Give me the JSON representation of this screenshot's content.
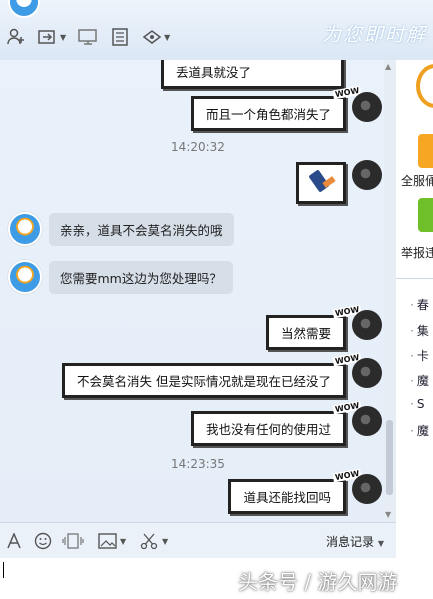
{
  "header": {
    "slogan": "为您即时解",
    "tool_icons": [
      "add-contact-icon",
      "transfer-icon",
      "screen-share-icon",
      "document-icon",
      "app-icon"
    ]
  },
  "messages": [
    {
      "type": "out",
      "text": "丢道具就没了"
    },
    {
      "type": "out",
      "text": "而且一个角色都消失了"
    },
    {
      "type": "time",
      "text": "14:20:32"
    },
    {
      "type": "out-image",
      "text": "",
      "image": "sticker-icon"
    },
    {
      "type": "in",
      "text": "亲亲，道具不会莫名消失的哦"
    },
    {
      "type": "in",
      "text": "您需要mm这边为您处理吗？"
    },
    {
      "type": "out",
      "text": "当然需要"
    },
    {
      "type": "out",
      "text": "不会莫名消失 但是实际情况就是现在已经没了"
    },
    {
      "type": "out",
      "text": "我也没有任何的使用过"
    },
    {
      "type": "time",
      "text": "14:23:35"
    },
    {
      "type": "out",
      "text": "道具还能找回吗"
    }
  ],
  "right_panel": {
    "service_label": "全服俑",
    "report_label": "举报违",
    "links": [
      "春",
      "集",
      "卡",
      "魔",
      "S",
      "魔"
    ]
  },
  "input_toolbar": {
    "history_label": "消息记录",
    "icons": [
      "font-icon",
      "emoji-icon",
      "shake-icon",
      "image-icon",
      "screenshot-icon"
    ]
  },
  "watermark": "头条号 / 游久网游"
}
